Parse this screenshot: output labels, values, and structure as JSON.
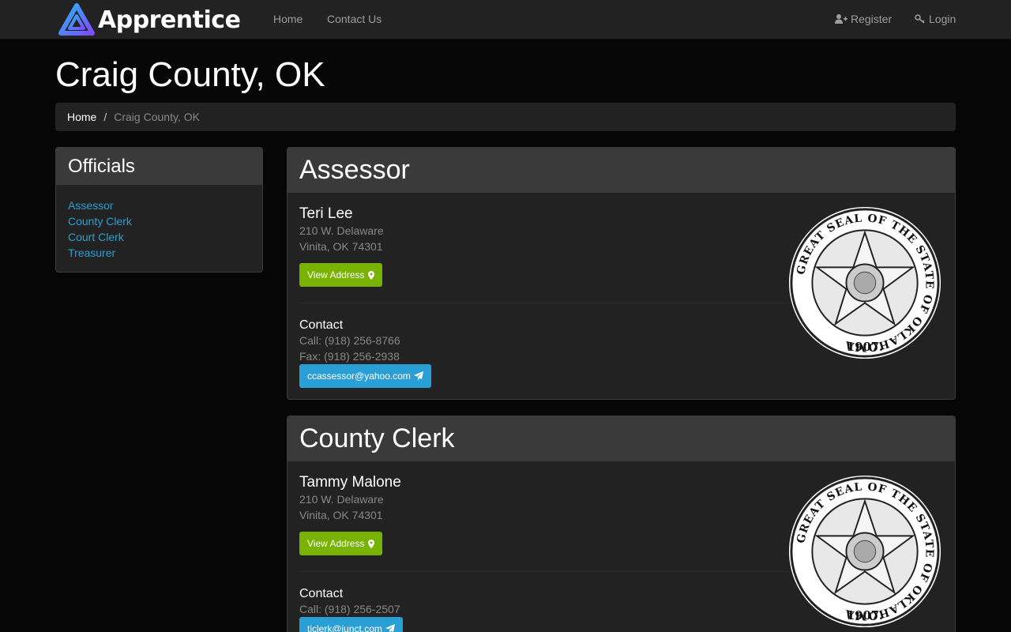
{
  "nav": {
    "brand": "Apprentice",
    "home": "Home",
    "contact": "Contact Us",
    "register": "Register",
    "login": "Login"
  },
  "page": {
    "title": "Craig County, OK"
  },
  "breadcrumb": {
    "home": "Home",
    "separator": "/",
    "current": "Craig County, OK"
  },
  "sidebar": {
    "title": "Officials",
    "items": [
      "Assessor",
      "County Clerk",
      "Court Clerk",
      "Treasurer"
    ]
  },
  "offices": [
    {
      "title": "Assessor",
      "name": "Teri Lee",
      "street": "210 W. Delaware",
      "city": "Vinita, OK 74301",
      "view_address": "View Address",
      "contact_label": "Contact",
      "call": "Call: (918) 256-8766",
      "fax": "Fax: (918) 256-2938",
      "email": "ccassessor@yahoo.com"
    },
    {
      "title": "County Clerk",
      "name": "Tammy Malone",
      "street": "210 W. Delaware",
      "city": "Vinita, OK 74301",
      "view_address": "View Address",
      "contact_label": "Contact",
      "call": "Call: (918) 256-2507",
      "email": "tjclerk@junct.com"
    }
  ],
  "colors": {
    "link": "#2a9fd6",
    "success": "#77b300",
    "panel": "#222222",
    "panel_header": "#3a3a3a"
  },
  "icons": {
    "brand": "triangle-logo-icon",
    "register": "user-plus-icon",
    "login": "key-icon",
    "map": "map-marker-icon",
    "email": "paper-plane-icon",
    "seal": "oklahoma-state-seal-icon"
  },
  "seal_text": {
    "ring": "GREAT SEAL OF THE STATE OF OKLAHOMA",
    "year": "1907."
  }
}
